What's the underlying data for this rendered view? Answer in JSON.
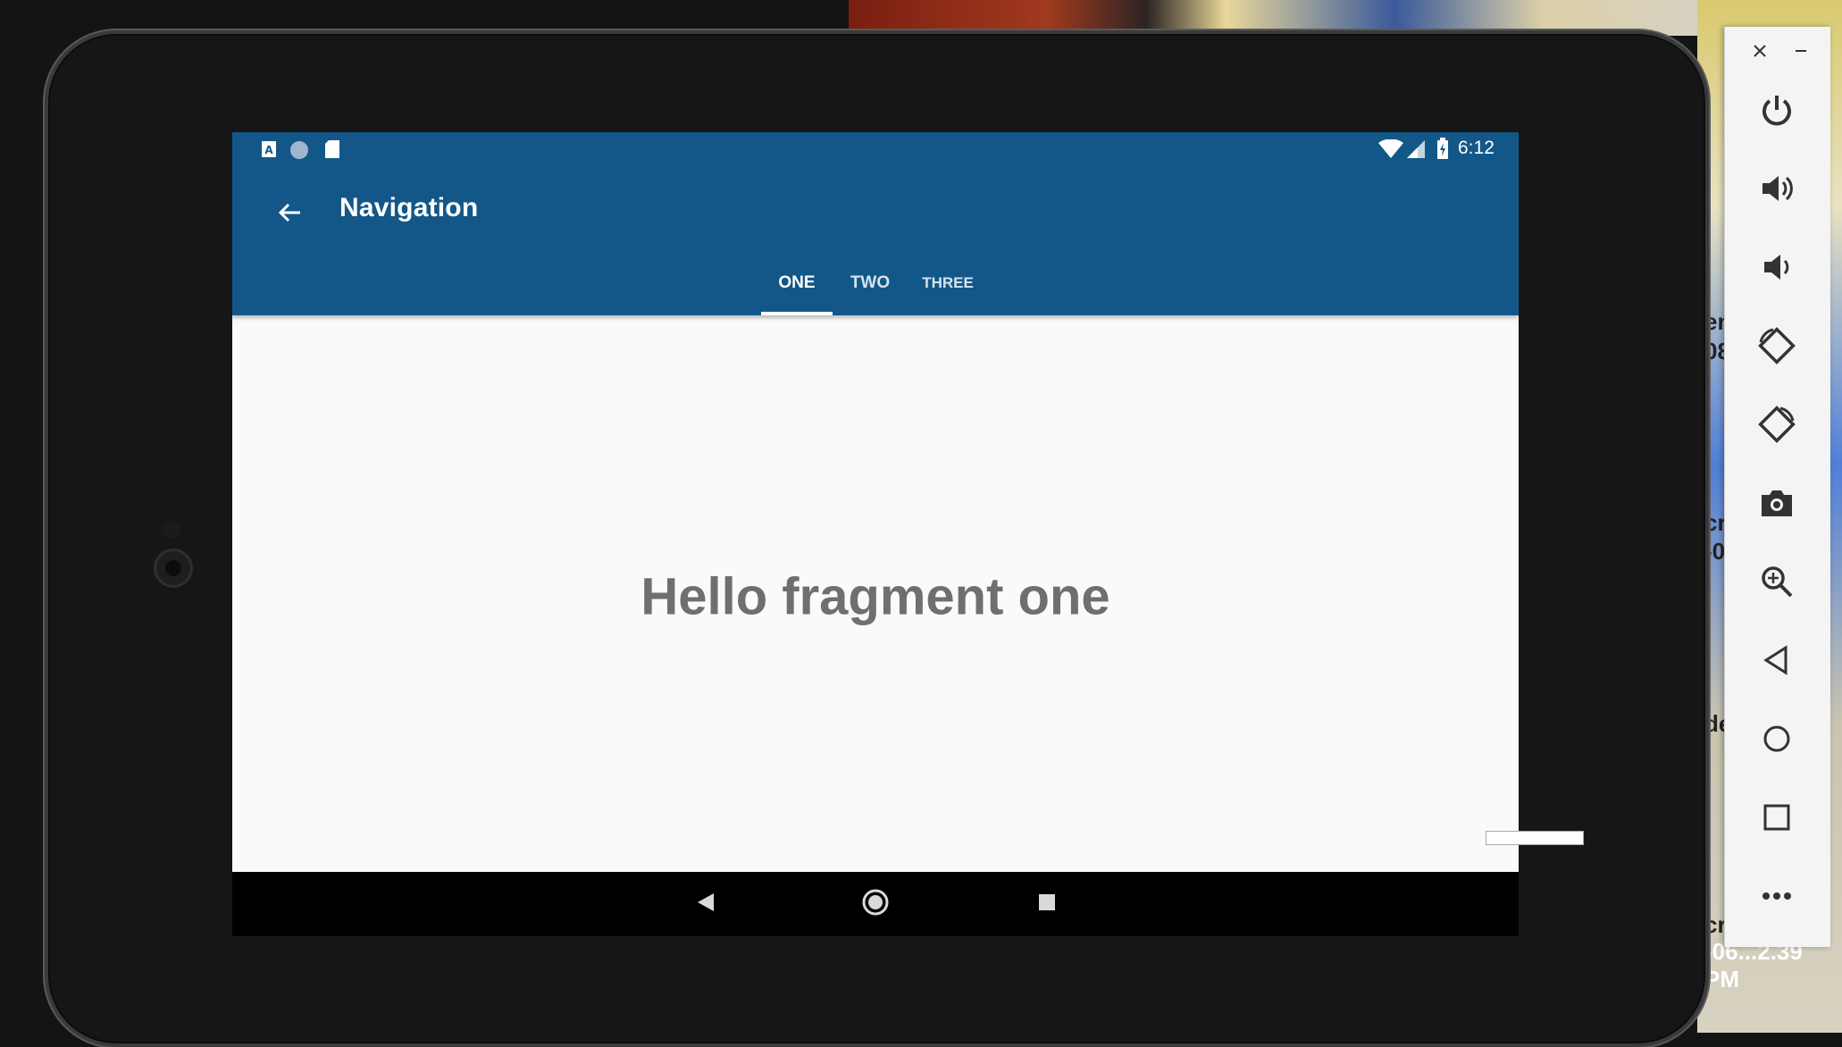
{
  "desktop": {
    "side_fragments": [
      "en",
      "08",
      "cr",
      "-0",
      "de",
      "cr"
    ],
    "bottom_fragment": "-06...2.39 PM"
  },
  "status_bar": {
    "time": "6:12",
    "icons": [
      "a-notification-icon",
      "circle-notification-icon",
      "sd-card-icon",
      "wifi-icon",
      "cell-signal-icon",
      "battery-icon"
    ]
  },
  "toolbar": {
    "title": "Navigation",
    "back_icon": "arrow-back-icon"
  },
  "tabs": [
    {
      "label": "ONE",
      "active": true
    },
    {
      "label": "TWO",
      "active": false
    },
    {
      "label": "THREE",
      "active": false
    }
  ],
  "content": {
    "message": "Hello fragment one"
  },
  "system_nav": [
    "back-triangle-icon",
    "home-circle-icon",
    "recents-square-icon"
  ],
  "emulator_panel": {
    "top_controls": [
      "close-icon",
      "minimize-icon"
    ],
    "buttons": [
      {
        "name": "power-button",
        "icon": "power-icon"
      },
      {
        "name": "volume-up-button",
        "icon": "volume-up-icon"
      },
      {
        "name": "volume-down-button",
        "icon": "volume-down-icon"
      },
      {
        "name": "rotate-left-button",
        "icon": "rotate-left-icon"
      },
      {
        "name": "rotate-right-button",
        "icon": "rotate-right-icon"
      },
      {
        "name": "screenshot-button",
        "icon": "camera-icon"
      },
      {
        "name": "zoom-button",
        "icon": "zoom-in-icon"
      },
      {
        "name": "back-button",
        "icon": "back-icon"
      },
      {
        "name": "home-button",
        "icon": "home-icon"
      },
      {
        "name": "overview-button",
        "icon": "overview-icon"
      },
      {
        "name": "more-button",
        "icon": "more-icon"
      }
    ]
  },
  "colors": {
    "app_bar": "#135789",
    "screen_background": "#fafafa",
    "message_text": "#6f6f6f"
  }
}
